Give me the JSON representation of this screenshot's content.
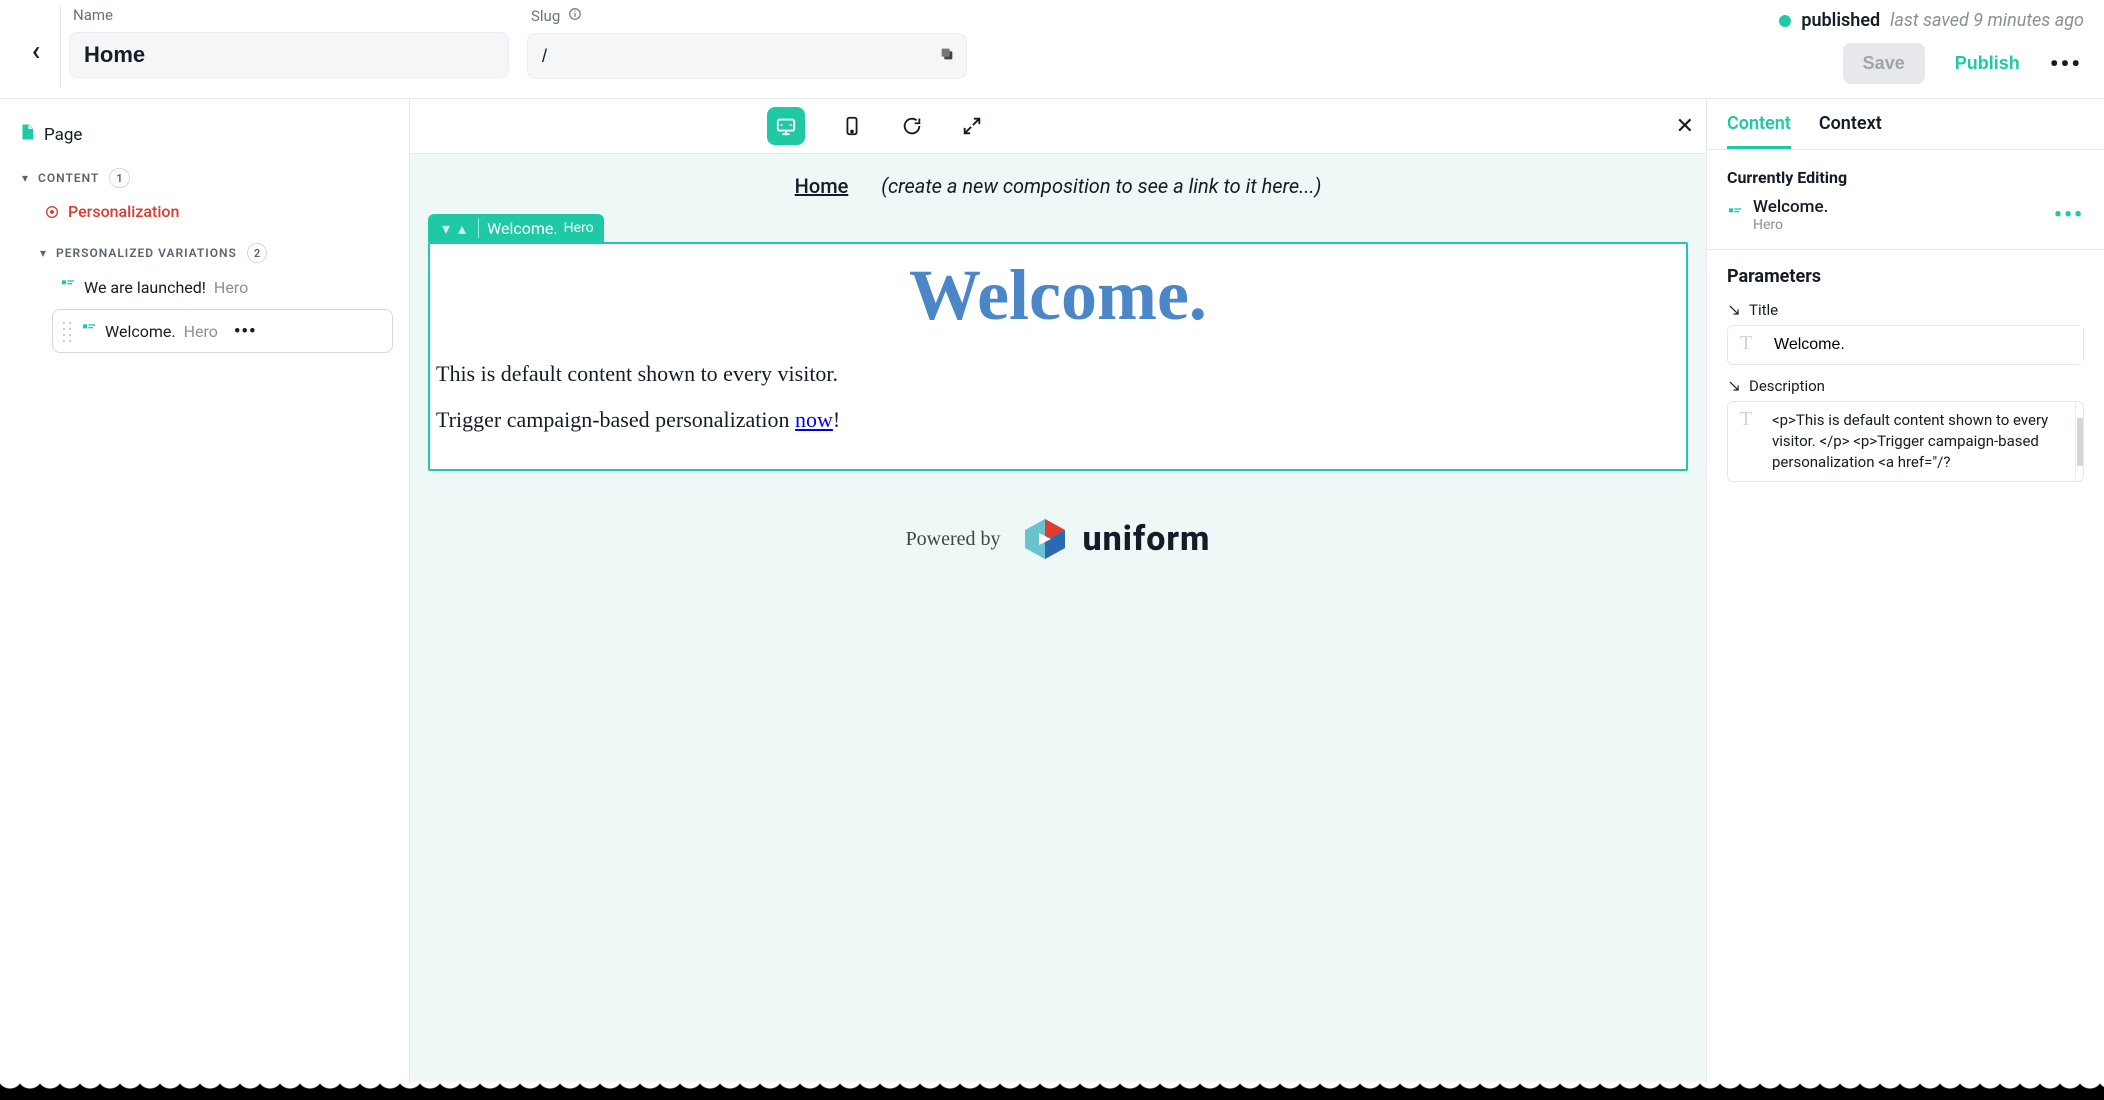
{
  "header": {
    "name_label": "Name",
    "name_value": "Home",
    "slug_label": "Slug",
    "slug_value": "/",
    "status": "published",
    "saved_text": "last saved 9 minutes ago",
    "save_label": "Save",
    "publish_label": "Publish"
  },
  "tree": {
    "root_label": "Page",
    "section_content": "CONTENT",
    "content_count": "1",
    "personalization_label": "Personalization",
    "section_variations": "PERSONALIZED VARIATIONS",
    "variations_count": "2",
    "variation1_name": "We are launched!",
    "variation1_type": "Hero",
    "variation2_name": "Welcome.",
    "variation2_type": "Hero"
  },
  "canvas": {
    "nav_home": "Home",
    "nav_hint": "(create a new composition to see a link to it here...)",
    "tag_name": "Welcome.",
    "tag_type": "Hero",
    "hero_title": "Welcome.",
    "hero_p1": "This is default content shown to every visitor.",
    "hero_p2_a": "Trigger campaign-based personalization ",
    "hero_p2_link": "now",
    "hero_p2_b": "!",
    "powered_by": "Powered by",
    "brand": "uniform"
  },
  "inspector": {
    "tab_content": "Content",
    "tab_context": "Context",
    "currently_editing": "Currently Editing",
    "ce_name": "Welcome.",
    "ce_type": "Hero",
    "parameters_heading": "Parameters",
    "param_title_label": "Title",
    "param_title_value": "Welcome.",
    "param_desc_label": "Description",
    "param_desc_value": "<p>This is default content shown to every visitor. </p>\n<p>Trigger campaign-based personalization <a href=\"/?"
  }
}
